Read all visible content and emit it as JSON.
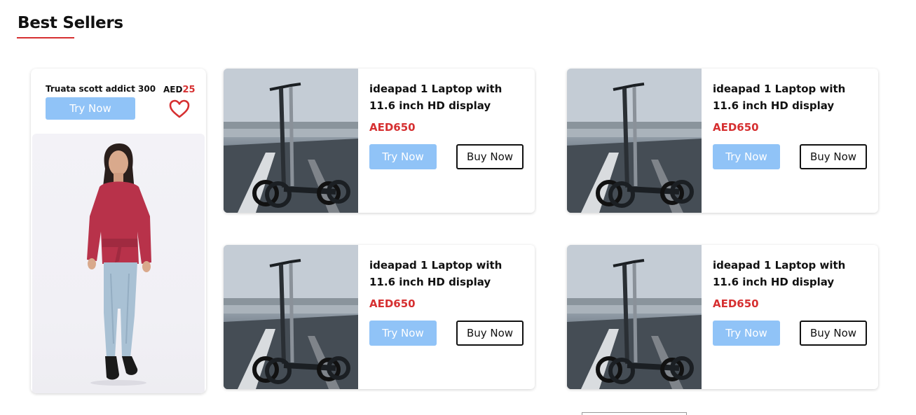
{
  "section": {
    "title": "Best Sellers"
  },
  "colors": {
    "accent": "#d63031",
    "try_button": "#90c3f7"
  },
  "featured": {
    "name": "Truata scott addict 300",
    "currency": "AED",
    "price": "25",
    "try_label": "Try Now",
    "icon": "heart-icon"
  },
  "products": [
    {
      "title": "ideapad 1 Laptop with 11.6 inch HD display",
      "price": "AED650",
      "try_label": "Try Now",
      "buy_label": "Buy Now"
    },
    {
      "title": "ideapad 1 Laptop with 11.6 inch HD display",
      "price": "AED650",
      "try_label": "Try Now",
      "buy_label": "Buy Now"
    },
    {
      "title": "ideapad 1 Laptop with 11.6 inch HD display",
      "price": "AED650",
      "try_label": "Try Now",
      "buy_label": "Buy Now"
    },
    {
      "title": "ideapad 1 Laptop with 11.6 inch HD display",
      "price": "AED650",
      "try_label": "Try Now",
      "buy_label": "Buy Now"
    }
  ]
}
